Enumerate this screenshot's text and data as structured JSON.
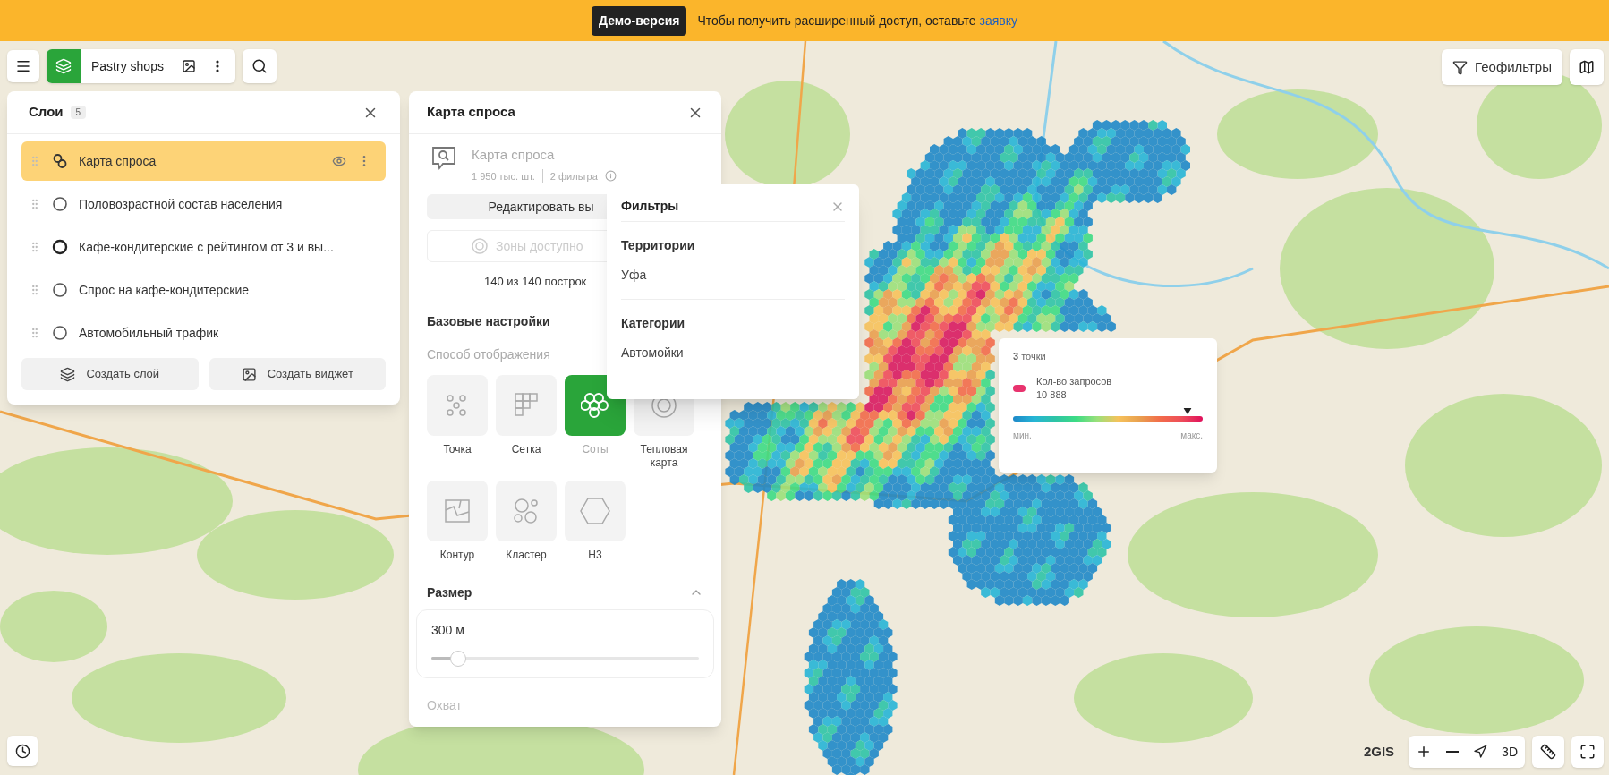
{
  "banner": {
    "badge": "Демо-версия",
    "text": "Чтобы получить расширенный доступ, оставьте",
    "link": "заявку"
  },
  "toolbar": {
    "project": "Pastry shops"
  },
  "geofilter_button": "Геофильтры",
  "layers_panel": {
    "title": "Слои",
    "count": "5",
    "items": [
      {
        "name": "Карта спроса",
        "kind": "demand",
        "selected": true
      },
      {
        "name": "Половозрастной состав населения",
        "kind": "ring",
        "selected": false
      },
      {
        "name": "Кафе-кондитерские с рейтингом от 3 и вы...",
        "kind": "ring-bold",
        "selected": false
      },
      {
        "name": "Спрос на кафе-кондитерские",
        "kind": "ring",
        "selected": false
      },
      {
        "name": "Автомобильный трафик",
        "kind": "ring",
        "selected": false
      }
    ],
    "buttons": [
      {
        "label": "Создать слой",
        "kind": "layer"
      },
      {
        "label": "Создать виджет",
        "kind": "widget"
      }
    ]
  },
  "demand_panel": {
    "title": "Карта спроса",
    "source": {
      "name": "Карта спроса",
      "count": "1 950 тыс. шт.",
      "filters": "2 фильтра"
    },
    "edit_button": "Редактировать вы",
    "zones_button": {
      "label": "Зоны доступно",
      "disabled": true
    },
    "built": "140 из 140 построк",
    "section": "Базовые настройки",
    "display_label": "Способ отображения",
    "modes": [
      {
        "label": "Точка",
        "kind": "point",
        "selected": false
      },
      {
        "label": "Сетка",
        "kind": "grid",
        "selected": false
      },
      {
        "label": "Соты",
        "kind": "hex",
        "selected": true
      },
      {
        "label": "Тепловая карта",
        "kind": "heat",
        "selected": false
      },
      {
        "label": "Контур",
        "kind": "contour",
        "selected": false
      },
      {
        "label": "Кластер",
        "kind": "cluster",
        "selected": false
      },
      {
        "label": "H3",
        "kind": "h3",
        "selected": false
      }
    ],
    "size": {
      "title": "Размер",
      "expanded": true,
      "value": "300 м",
      "level": 0.1
    },
    "coverage": "Охват"
  },
  "filters_popup": {
    "title": "Фильтры",
    "groups": [
      {
        "title": "Территории",
        "value": "Уфа"
      },
      {
        "title": "Категории",
        "value": "Автомойки"
      }
    ]
  },
  "legend": {
    "count": "**3** точки",
    "metric": "Кол-во запросов",
    "value": "10 888",
    "level": 0.92,
    "min": "мин.",
    "max": "макс."
  },
  "map_controls": {
    "logo": "2GIS",
    "mode_3d": "3D"
  }
}
